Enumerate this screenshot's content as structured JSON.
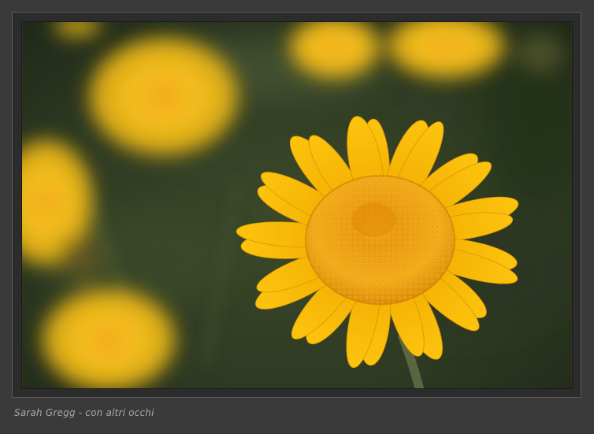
{
  "caption": {
    "text": "Sarah Gregg - con altri occhi"
  },
  "colors": {
    "background": "#3a3a3a",
    "frame_border": "#5a5a5a",
    "caption": "#a8a8a8",
    "petal": "#f5b800",
    "disc": "#e89a0c",
    "foliage": "#2f3a22"
  }
}
